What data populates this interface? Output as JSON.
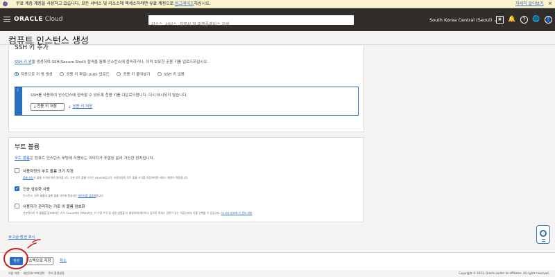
{
  "promo_bar": {
    "text": "무료 계층 계정을 사용하고 있습니다. 모든 서비스 및 리소스에 액세스하려면 유료 계정으로 ",
    "upgrade_link": "업그레이드",
    "text_suffix": "하십시오.",
    "more_link": "자세히 알아보기",
    "close_glyph": "×",
    "icon_glyph": "ⓘ"
  },
  "header": {
    "logo": "ORACLE",
    "logo_suffix": " Cloud",
    "search_placeholder": "리소스, 서비스, 설명서 및 마켓플레이스 검색",
    "region": "South Korea Central (Seoul)",
    "region_chevron": "⌄",
    "icons": [
      "cloud-shell-icon",
      "code-editor-icon",
      "bell-icon",
      "help-icon",
      "globe-icon",
      "profile-icon"
    ],
    "icon_glyphs": [
      "▣",
      "</>",
      "🔔",
      "?",
      "🌐",
      "👤"
    ]
  },
  "page_title": "컴퓨트 인스턴스 생성",
  "ssh_section": {
    "heading": "SSH 키 추가",
    "desc_link": "SSH 키 쌍",
    "desc": "을 생성하여 SSH(Secure Shell) 접속을 통해 인스턴스에 접속하거나, 이미 보유한 공용 키를 업로드하십시오.",
    "options": [
      {
        "label": "자동으로 키 쌍 생성",
        "selected": true
      },
      {
        "label": "공용 키 파일(.pub) 업로드",
        "selected": false
      },
      {
        "label": "공용 키 붙여넣기",
        "selected": false
      },
      {
        "label": "SSH 키 없음",
        "selected": false
      }
    ],
    "info_text": "SSH를 사용하여 인스턴스에 접속할 수 있도록 전용 키를 다운로드합니다. 다시 표시되지 않습니다.",
    "info_icon": "i",
    "save_private_key": "전용 키 저장",
    "save_public_key": "공용 키 저장",
    "download_glyph": "⤓"
  },
  "boot_section": {
    "heading": "부트 볼륨",
    "desc_link": "부트 볼륨",
    "desc": "은 컴퓨트 인스턴스 부팅에 사용되는 이미지가 포함된 분리 가능한 장치입니다.",
    "options": [
      {
        "label": "사용자정의 부트 볼륨 크기 지정",
        "checked": false,
        "help_link": "볼륨 성능",
        "help": "은 볼륨 크기에 따라 달라집니다. 기본 부트 볼륨 크기는 46.6GB입니다. 사용자정의 부트 볼륨 크기를 지정하려면 서비스 제한이 적용됩니다."
      },
      {
        "label": "전송 암호화 사용",
        "checked": true,
        "help": "인스턴스, 부트 볼륨과 블록 볼륨 사이에 전송되는 ",
        "help_link": "데이터를 암호화",
        "help_suffix": "합니다."
      },
      {
        "label": "사용자가 관리하는 키로 이 볼륨 암호화",
        "checked": false,
        "help": "기본적으로 이 볼륨을 암호화하는 키가 Oracle에서 관리되지만, 키 수명 주기 및 사용 방법을 더 세밀하게 제어하고 앞으로 액세스 권한이 있는 저장소에서 키를 선택할 수 있습니다. ",
        "help_link": "내 고유 암호화 키 관리 방법"
      }
    ],
    "check_glyph": "✓"
  },
  "advanced_link": "고급 옵션 표시",
  "advanced_glyph": "⚙",
  "actions": {
    "create": "생성",
    "save_as_stack": "스택으로 저장",
    "cancel": "취소"
  },
  "annotation": {
    "color": "#d11b1b"
  },
  "footer": {
    "links": [
      "이용 약관",
      "개인정보 보호정책",
      "쿠키 환경설정"
    ],
    "copyright": "Copyright © 2023, Oracle and/or its affiliates. All rights reserved."
  },
  "colors": {
    "accent": "#2b6dbf",
    "topbar": "#312d2a",
    "promo": "#fbf3d0"
  }
}
